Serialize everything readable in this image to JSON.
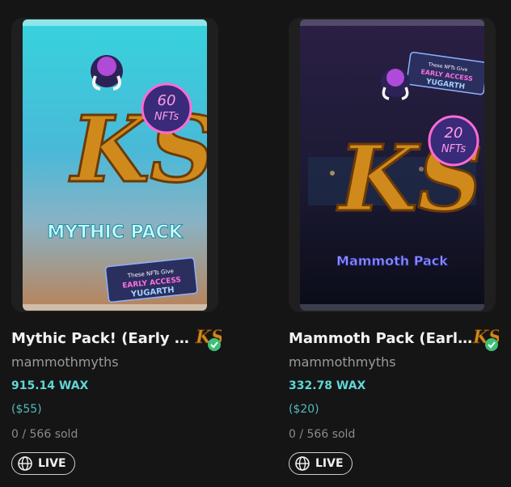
{
  "cards": [
    {
      "title": "Mythic Pack! (Early Ac...",
      "creator": "mammothmyths",
      "price": "915.14 WAX",
      "usd": "($55)",
      "sold": "0 / 566 sold",
      "status": "LIVE",
      "pack_art": {
        "logo": "KS",
        "count_badge": "60 NFTs",
        "label": "MYTHIC PACK",
        "sticker": "These NFTs Give EARLY ACCESS To YUGARTH",
        "colors": {
          "top": "#3fd8e0",
          "bottom": "#c98a5a",
          "label": "#bff6ff"
        }
      },
      "badge_icon": "ks-verified-icon"
    },
    {
      "title": "Mammoth Pack (Early ...",
      "creator": "mammothmyths",
      "price": "332.78 WAX",
      "usd": "($20)",
      "sold": "0 / 566 sold",
      "status": "LIVE",
      "pack_art": {
        "logo": "KS",
        "count_badge": "20 NFTs",
        "label": "Mammoth Pack",
        "sticker": "These NFTs Give EARLY ACCESS To YUGARTH",
        "colors": {
          "top": "#2a1d42",
          "bottom": "#0e0f1e",
          "label": "#7a7cff"
        }
      },
      "badge_icon": "ks-verified-icon"
    }
  ],
  "accent_color": "#5fd6d6"
}
